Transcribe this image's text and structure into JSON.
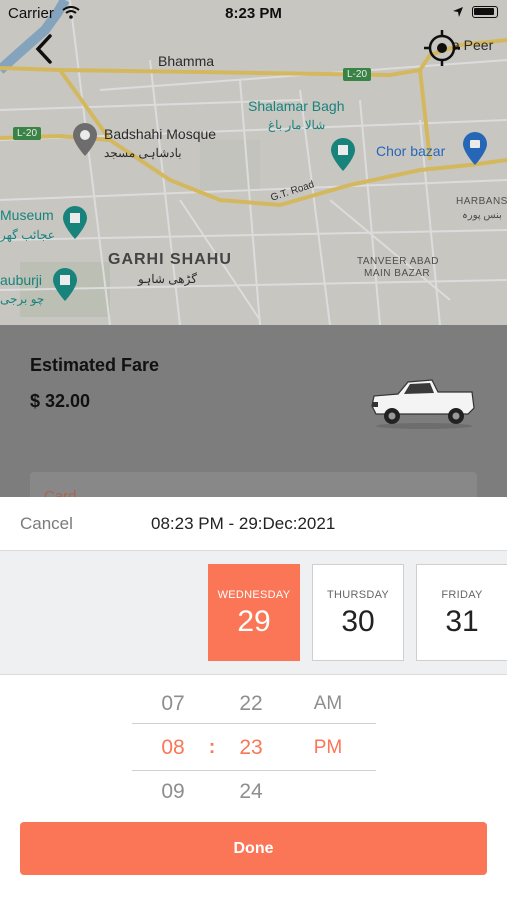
{
  "status_bar": {
    "carrier": "Carrier",
    "time": "8:23 PM"
  },
  "map": {
    "labels": {
      "bhamma": "Bhamma",
      "shalamar": "Shalamar Bagh",
      "shalamar_ur": "شالا مار باغ",
      "badshahi": "Badshahi Mosque",
      "badshahi_ur": "بادشاہی مسجد",
      "chor": "Chor bazar",
      "gt_road": "G.T. Road",
      "museum": "Museum",
      "museum_ur": "عجائب گھر",
      "harbans": "HARBANS",
      "harbans_ur": "بنس پورہ",
      "garhi": "GARHI SHAHU",
      "garhi_ur": "گڑھی شاہو",
      "tanveer": "TANVEER ABAD",
      "main_bazar": "MAIN BAZAR",
      "nauburji": "auburji",
      "nauburji_ur": "چو برجی",
      "peer": "a Peer",
      "l20_top": "L-20",
      "l20_left": "L-20"
    }
  },
  "fare": {
    "title": "Estimated Fare",
    "amount": "$ 32.00",
    "card_label": "Card"
  },
  "picker": {
    "cancel_label": "Cancel",
    "selected": "08:23 PM - 29:Dec:2021",
    "days": [
      {
        "name": "WEDNESDAY",
        "num": "29",
        "active": true
      },
      {
        "name": "THURSDAY",
        "num": "30",
        "active": false
      },
      {
        "name": "FRIDAY",
        "num": "31",
        "active": false
      }
    ],
    "hours": [
      "07",
      "08",
      "09"
    ],
    "minutes": [
      "22",
      "23",
      "24"
    ],
    "periods": [
      "AM",
      "PM"
    ],
    "separator": ":",
    "done_label": "Done"
  },
  "colors": {
    "accent": "#fb7656",
    "map_bg": "#dad7d2",
    "overlay": "#7d7d7d"
  }
}
